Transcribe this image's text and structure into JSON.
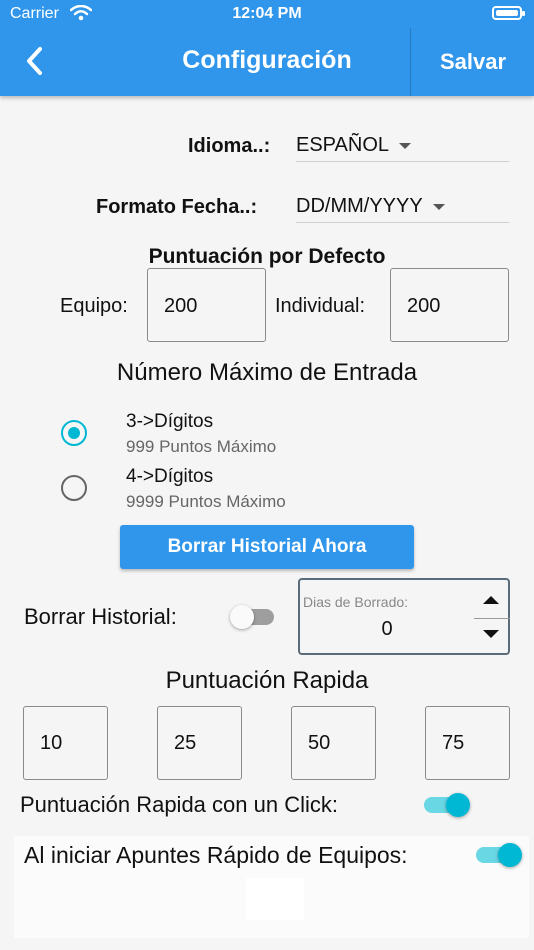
{
  "status_bar": {
    "carrier": "Carrier",
    "time": "12:04 PM"
  },
  "header": {
    "title": "Configuración",
    "save_label": "Salvar"
  },
  "language": {
    "label": "Idioma..:",
    "value": "ESPAÑOL"
  },
  "date_format": {
    "label": "Formato Fecha..:",
    "value": "DD/MM/YYYY"
  },
  "default_score": {
    "title": "Puntuación por Defecto",
    "team_label": "Equipo:",
    "team_value": "200",
    "individual_label": "Individual:",
    "individual_value": "200"
  },
  "max_entry": {
    "title": "Número Máximo de Entrada",
    "options": [
      {
        "title": "3->Dígitos",
        "subtitle": "999 Puntos Máximo",
        "selected": true
      },
      {
        "title": "4->Dígitos",
        "subtitle": "9999 Puntos Máximo",
        "selected": false
      }
    ]
  },
  "clear_history": {
    "button_label": "Borrar Historial Ahora",
    "label": "Borrar Historial:",
    "enabled": false,
    "days_label": "Dias de Borrado:",
    "days_value": "0"
  },
  "quick_score": {
    "title": "Puntuación Rapida",
    "values": [
      "10",
      "25",
      "50",
      "75"
    ],
    "one_click_label": "Puntuación Rapida con un Click:",
    "one_click_enabled": true
  },
  "startup": {
    "label": "Al iniciar Apuntes Rápido de Equipos:",
    "enabled": true
  },
  "colors": {
    "primary": "#2f96ec",
    "accent": "#00b8d4"
  }
}
